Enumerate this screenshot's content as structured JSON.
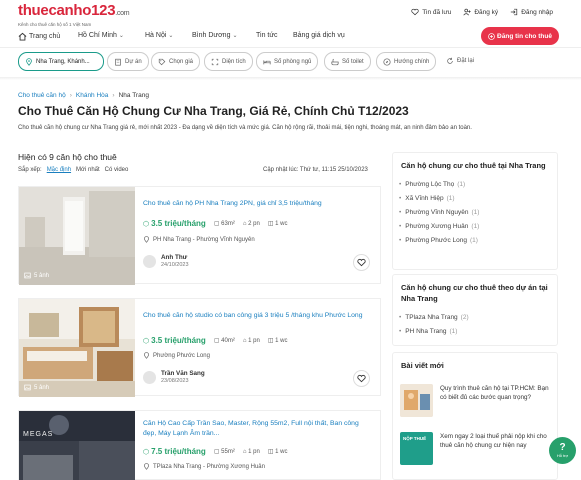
{
  "header": {
    "logo_main": "thuecanho",
    "logo_num": "123",
    "logo_dom": ".com",
    "logo_sub": "Kênh cho thuê căn hộ số 1 Việt Nam",
    "links": {
      "saved": "Tin đã lưu",
      "register": "Đăng ký",
      "login": "Đăng nhập"
    }
  },
  "nav": {
    "home": "Trang chủ",
    "hcm": "Hồ Chí Minh",
    "hanoi": "Hà Nội",
    "binhduong": "Bình Dương",
    "news": "Tin tức",
    "pricing": "Bảng giá dịch vụ",
    "post_button": "Đăng tin cho thuê"
  },
  "filters": {
    "location": "Nha Trang, Khánh...",
    "project": "Dự án",
    "price": "Chọn giá",
    "area": "Diện tích",
    "bedrooms": "Số phòng ngủ",
    "toilets": "Số toilet",
    "direction": "Hướng chính",
    "reset": "Đặt lại"
  },
  "breadcrumb": [
    "Cho thuê căn hộ",
    "Khánh Hòa",
    "Nha Trang"
  ],
  "page": {
    "title": "Cho Thuê Căn Hộ Chung Cư Nha Trang, Giá Rẻ, Chính Chủ T12/2023",
    "description": "Cho thuê căn hộ chung cư Nha Trang giá rẻ, mới nhất 2023 - Đa dạng về diện tích và mức giá. Căn hộ rộng rãi, thoải mái, tiện nghi, thoáng mát, an ninh đảm bảo an toàn.",
    "count": "Hiện có 9 căn hộ cho thuê",
    "sort_label": "Sắp xếp:",
    "sort_default": "Mặc định",
    "sort_newest": "Mới nhất",
    "sort_video": "Có video",
    "updated": "Cập nhật lúc: Thứ tư, 11:15 25/10/2023"
  },
  "listings": [
    {
      "title": "Cho thuê căn hộ PH Nha Trang 2PN, giá chỉ 3,5 triệu/tháng",
      "price": "3.5 triệu/tháng",
      "area": "63m²",
      "beds": "2 pn",
      "baths": "1 wc",
      "location": "PH Nha Trang - Phường Vĩnh Nguyên",
      "author": "Anh Thư",
      "date": "24/10/2023",
      "images": "5 ảnh"
    },
    {
      "title": "Cho thuê căn hộ studio có ban công giá 3 triệu 5 /tháng khu Phước Long",
      "price": "3.5 triệu/tháng",
      "area": "40m²",
      "beds": "1 pn",
      "baths": "1 wc",
      "location": "Phường Phước Long",
      "author": "Trần Văn Sang",
      "date": "23/08/2023",
      "images": "5 ảnh"
    },
    {
      "title": "Căn Hộ Cao Cấp Trần Sao, Master, Rộng 55m2, Full nội thất, Ban công đẹp, Máy Lạnh Âm trần...",
      "price": "7.5 triệu/tháng",
      "area": "55m²",
      "beds": "1 pn",
      "baths": "1 wc",
      "location": "TPlaza Nha Trang - Phường Xương Huân",
      "thumb_text": "MEGAS"
    }
  ],
  "sidebar": {
    "box1_title": "Căn hộ chung cư cho thuê tại Nha Trang",
    "box1_items": [
      {
        "name": "Phường Lộc Thọ",
        "count": "(1)"
      },
      {
        "name": "Xã Vĩnh Hiệp",
        "count": "(1)"
      },
      {
        "name": "Phường Vĩnh Nguyên",
        "count": "(1)"
      },
      {
        "name": "Phường Xương Huân",
        "count": "(1)"
      },
      {
        "name": "Phường Phước Long",
        "count": "(1)"
      }
    ],
    "box2_title": "Căn hộ chung cư cho thuê theo dự án tại Nha Trang",
    "box2_items": [
      {
        "name": "TPlaza Nha Trang",
        "count": "(2)"
      },
      {
        "name": "PH Nha Trang",
        "count": "(1)"
      }
    ],
    "box3_title": "Bài viết mới",
    "articles": [
      {
        "title": "Quy trình thuê căn hộ tại TP.HCM: Bạn có biết đủ các bước quan trọng?"
      },
      {
        "title": "Xem ngay 2 loại thuế phải nộp khi cho thuê căn hộ chung cư hiện nay",
        "thumb_text": "NỘP THUẾ"
      }
    ]
  },
  "chat": {
    "label": "Hỗ trợ",
    "icon": "?"
  },
  "colors": {
    "brand": "#d9263c",
    "link": "#1a7fbf",
    "price": "#27a06b",
    "accent": "#1a9b8a"
  }
}
